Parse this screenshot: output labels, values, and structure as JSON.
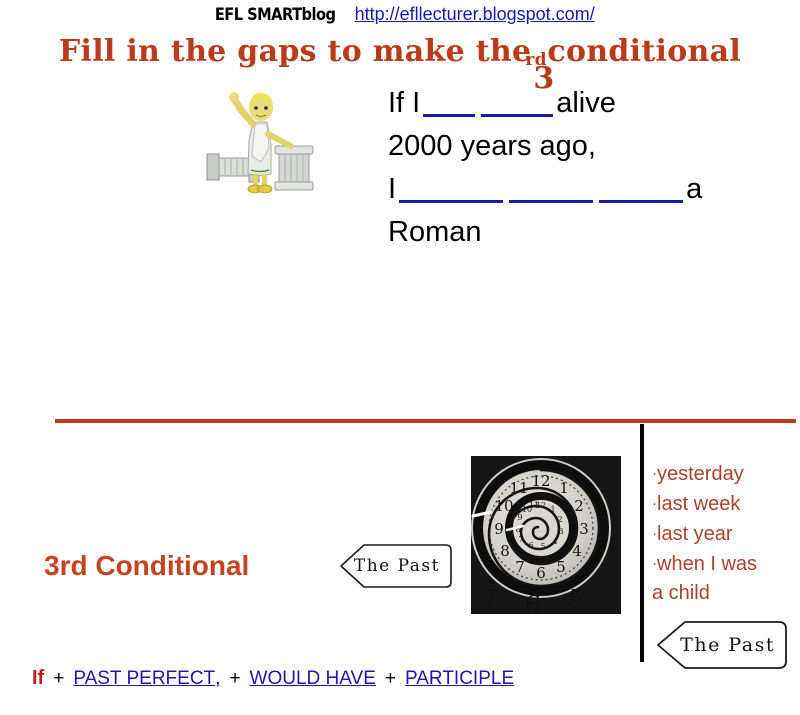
{
  "header": {
    "blog_name": "EFL SMARTblog",
    "blog_url": "http://efllecturer.blogspot.com/"
  },
  "title": {
    "before": "Fill in the gaps to make the",
    "ordinal_number": "3",
    "ordinal_suffix": "rd",
    "after": "conditional"
  },
  "gapfill": {
    "line1_a": "If I",
    "line1_b": "alive",
    "line2": "2000 years ago,",
    "line3_a": "I",
    "line3_b": "a",
    "line4": "Roman"
  },
  "lower": {
    "conditional_label": "3rd Conditional",
    "past_arrow_left": "The Past",
    "past_arrow_right": "The Past"
  },
  "time_expressions": {
    "bullet": "·",
    "items": [
      "yesterday",
      "last week",
      "last year",
      "when I was"
    ],
    "wrap": "a child"
  },
  "formula": {
    "if": "If",
    "plus1": "+",
    "term1": "PAST PERFECT ",
    "comma": ",",
    "plus2": "+",
    "term2": "WOULD HAVE",
    "plus3": "+",
    "term3": "PARTICIPLE"
  },
  "colors": {
    "title_red": "#BA3A19",
    "label_orange": "#C7421E",
    "link_blue": "#1a1aa8",
    "time_brown": "#A8432A",
    "if_red": "#C11C1C"
  },
  "images": {
    "statue": "roman-statue-illustration",
    "clock": "spiral-clock-photo"
  }
}
